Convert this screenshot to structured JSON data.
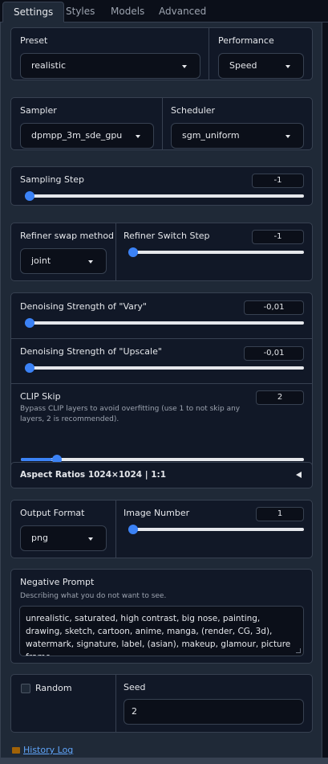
{
  "tabs": [
    {
      "label": "Settings",
      "active": true
    },
    {
      "label": "Styles"
    },
    {
      "label": "Models"
    },
    {
      "label": "Advanced"
    }
  ],
  "preset": {
    "label": "Preset",
    "value": "realistic"
  },
  "performance": {
    "label": "Performance",
    "value": "Speed"
  },
  "sampler": {
    "label": "Sampler",
    "value": "dpmpp_3m_sde_gpu"
  },
  "scheduler": {
    "label": "Scheduler",
    "value": "sgm_uniform"
  },
  "sampling_step": {
    "label": "Sampling Step",
    "value": "-1",
    "fraction": 0.0
  },
  "refiner_swap": {
    "label": "Refiner swap method",
    "value": "joint"
  },
  "refiner_switch": {
    "label": "Refiner Switch Step",
    "value": "-1",
    "fraction": 0.0
  },
  "denoise_vary": {
    "label": "Denoising Strength of \"Vary\"",
    "value": "-0,01",
    "fraction": 0.0
  },
  "denoise_upscale": {
    "label": "Denoising Strength of \"Upscale\"",
    "value": "-0,01",
    "fraction": 0.0
  },
  "clip_skip": {
    "label": "CLIP Skip",
    "info": "Bypass CLIP layers to avoid overfitting (use 1 to not skip any layers, 2 is recommended).",
    "value": "2",
    "fraction": 0.11
  },
  "aspect_ratios": {
    "label": "Aspect Ratios 1024×1024 | 1:1"
  },
  "output_format": {
    "label": "Output Format",
    "value": "png"
  },
  "image_number": {
    "label": "Image Number",
    "value": "1",
    "fraction": 0.0
  },
  "negative_prompt": {
    "label": "Negative Prompt",
    "info": "Describing what you do not want to see.",
    "value": "unrealistic, saturated, high contrast, big nose, painting, drawing, sketch, cartoon, anime, manga, (render, CG, 3d), watermark, signature, label, (asian), makeup, glamour, picture frame,"
  },
  "random": {
    "label": "Random",
    "checked": false
  },
  "seed": {
    "label": "Seed",
    "value": "2"
  },
  "history_log": {
    "label": "History Log"
  },
  "colors": {
    "accent": "#3b82f6",
    "panel": "#111827",
    "background": "#1f2937",
    "link": "#60a5fa"
  }
}
